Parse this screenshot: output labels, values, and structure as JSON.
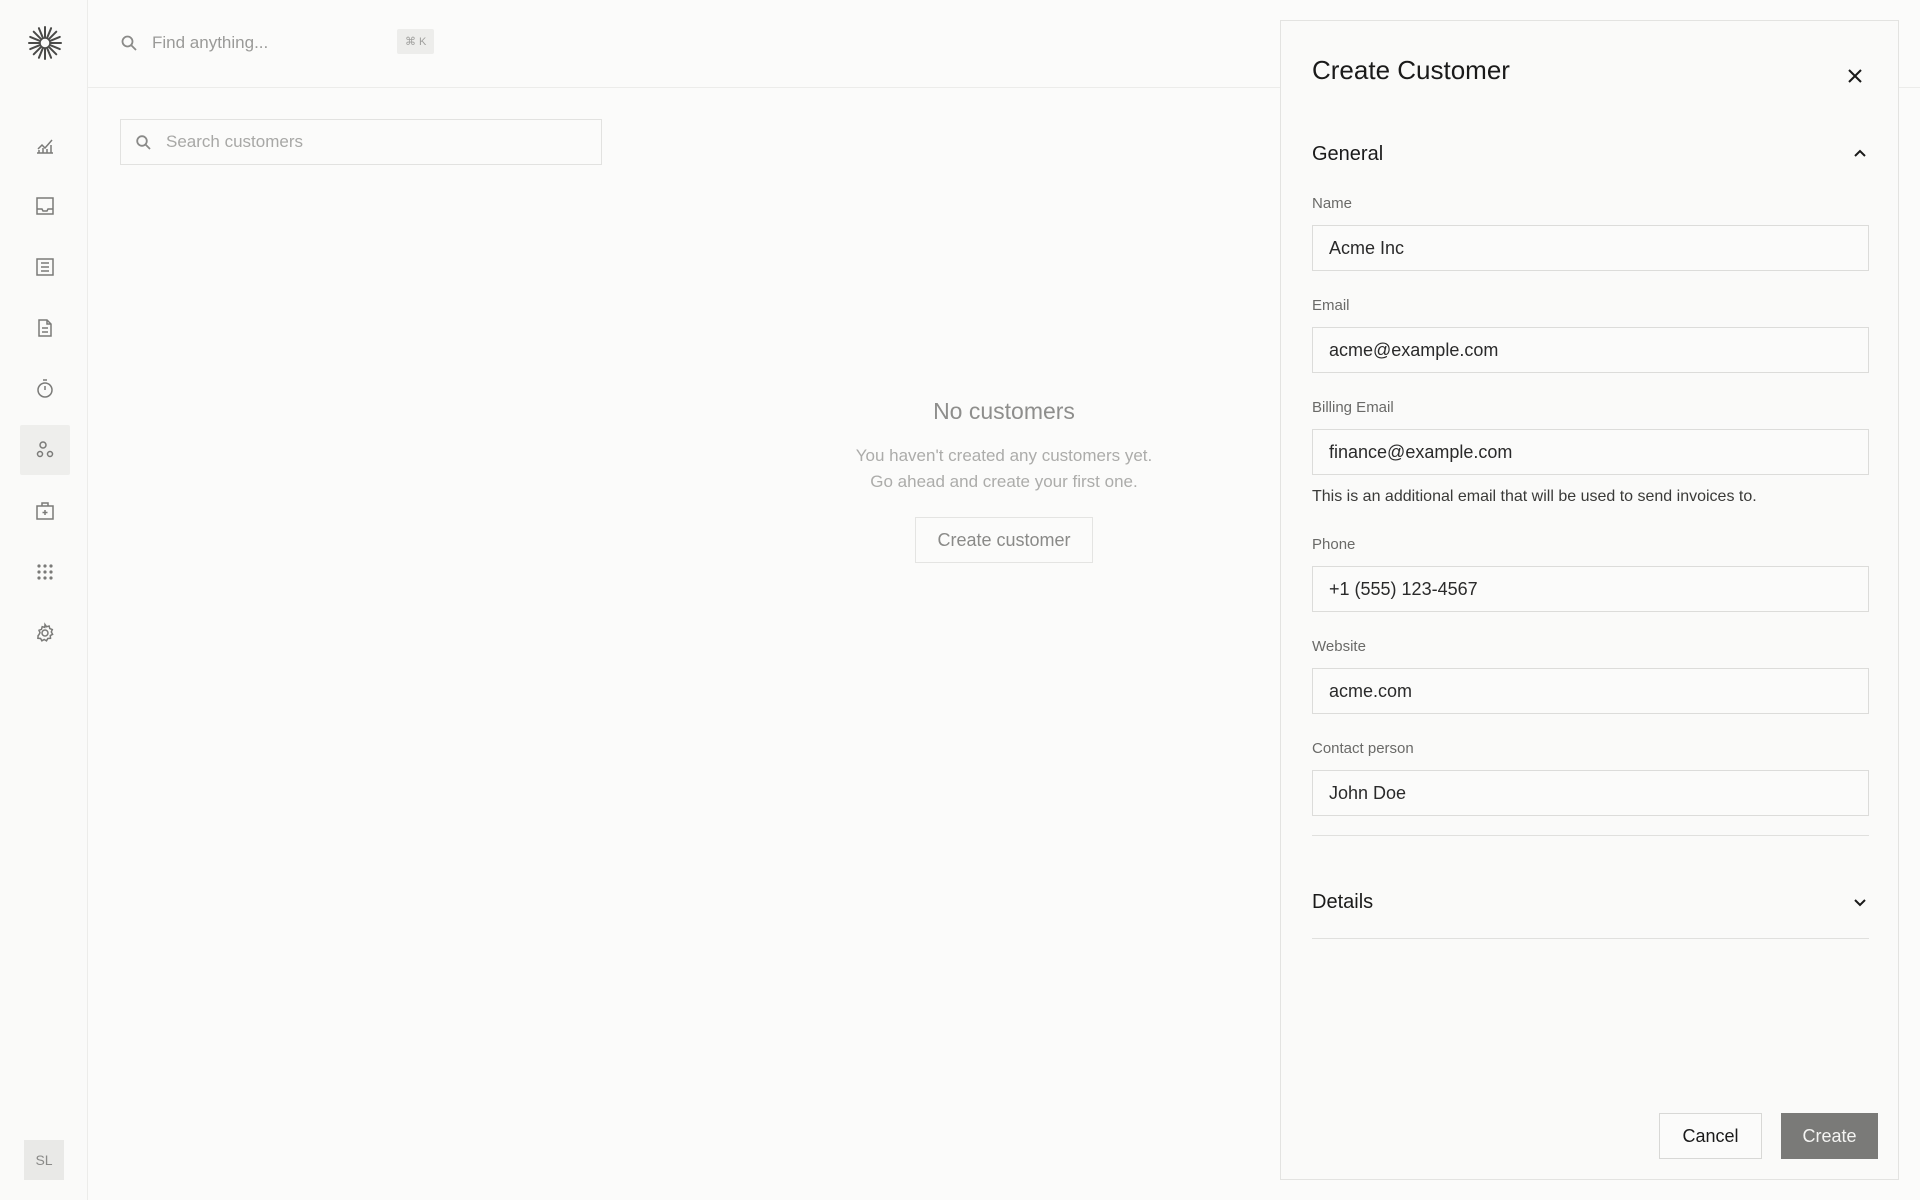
{
  "topbar": {
    "find_placeholder": "Find anything...",
    "shortcut": "⌘ K"
  },
  "sidebar": {
    "items": [
      {
        "icon": "chart-icon"
      },
      {
        "icon": "inbox-icon"
      },
      {
        "icon": "table-icon"
      },
      {
        "icon": "document-icon"
      },
      {
        "icon": "timer-icon"
      },
      {
        "icon": "customers-icon",
        "active": true
      },
      {
        "icon": "vault-icon"
      },
      {
        "icon": "apps-icon"
      },
      {
        "icon": "gear-icon"
      }
    ],
    "avatar_initials": "SL"
  },
  "customers": {
    "search_placeholder": "Search customers",
    "empty_title": "No customers",
    "empty_line1": "You haven't created any customers yet.",
    "empty_line2": "Go ahead and create your first one.",
    "create_button": "Create customer"
  },
  "drawer": {
    "title": "Create Customer",
    "general_label": "General",
    "details_label": "Details",
    "fields": {
      "name": {
        "label": "Name",
        "value": "Acme Inc"
      },
      "email": {
        "label": "Email",
        "value": "acme@example.com"
      },
      "billing_email": {
        "label": "Billing Email",
        "value": "finance@example.com",
        "help": "This is an additional email that will be used to send invoices to."
      },
      "phone": {
        "label": "Phone",
        "value": "+1 (555) 123-4567"
      },
      "website": {
        "label": "Website",
        "value": "acme.com"
      },
      "contact": {
        "label": "Contact person",
        "value": "John Doe"
      }
    },
    "cancel_label": "Cancel",
    "create_label": "Create"
  },
  "colors": {
    "background": "#fbfbfa",
    "primary_button": "#7a7a78",
    "border": "#dcdcda"
  }
}
